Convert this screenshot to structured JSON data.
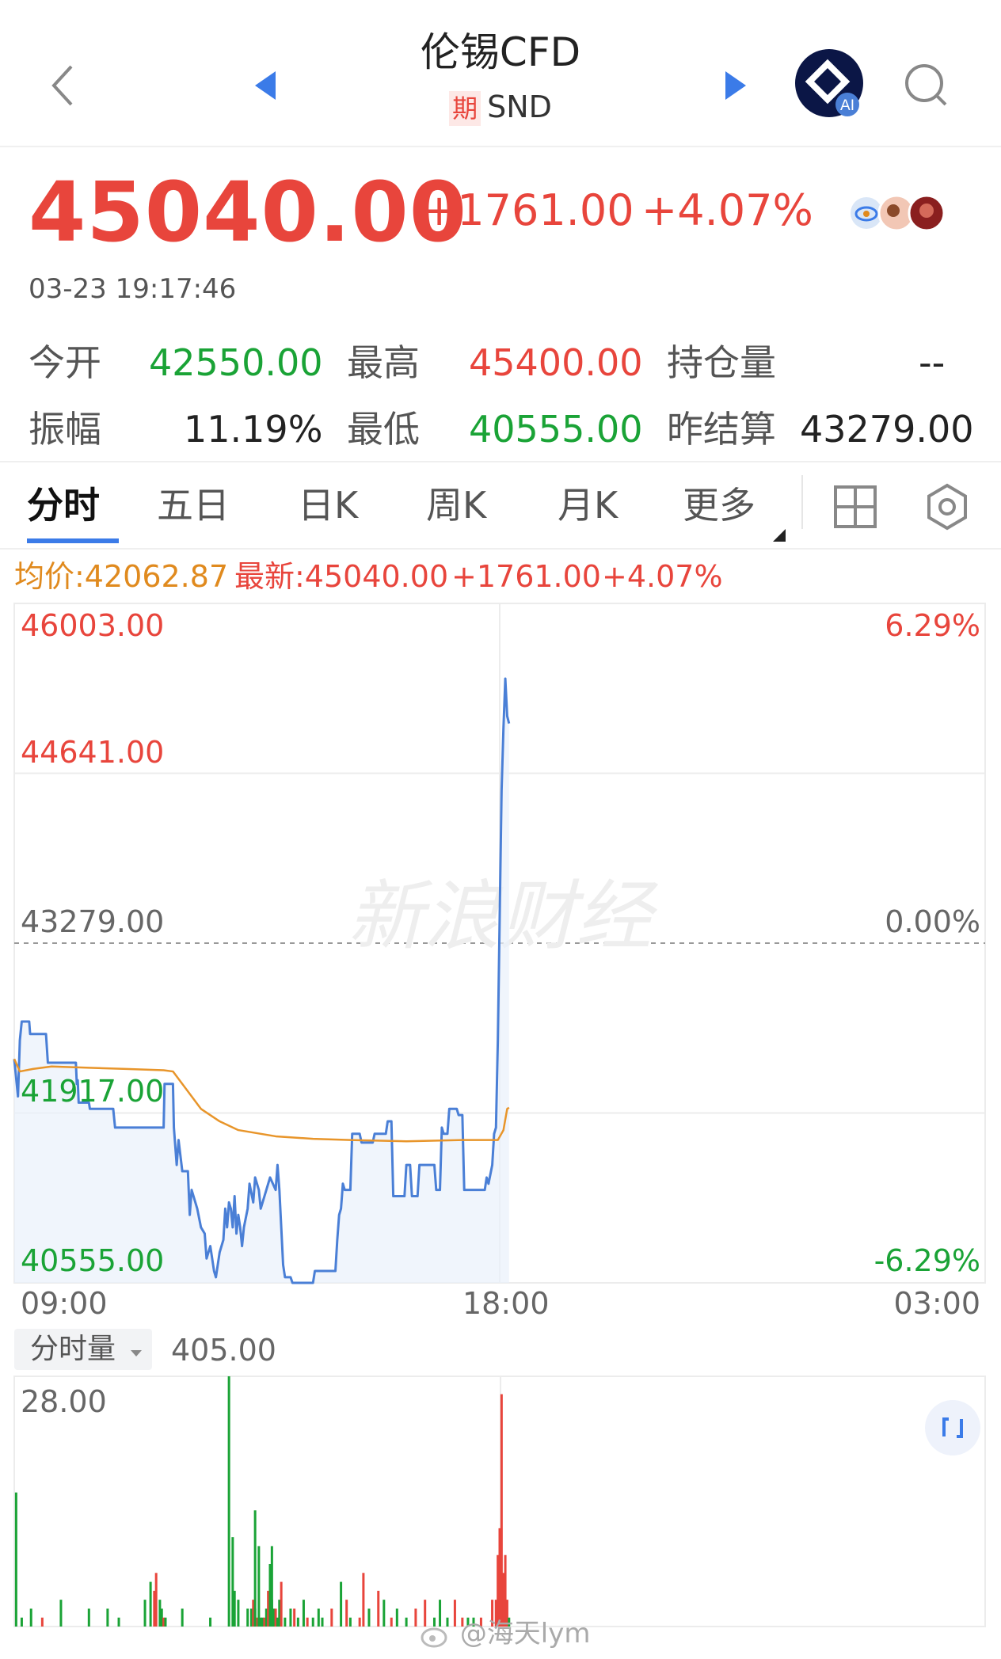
{
  "header": {
    "title": "伦锡CFD",
    "tag": "期",
    "code": "SND",
    "ai_badge": "AI"
  },
  "quote": {
    "price": "45040.00",
    "change": "+1761.00",
    "change_pct": "+4.07%",
    "datetime": "03-23 19:17:46"
  },
  "stats": {
    "open_label": "今开",
    "open": "42550.00",
    "high_label": "最高",
    "high": "45400.00",
    "oi_label": "持仓量",
    "oi": "--",
    "amp_label": "振幅",
    "amp": "11.19%",
    "low_label": "最低",
    "low": "40555.00",
    "settle_label": "昨结算",
    "settle": "43279.00"
  },
  "tabs": [
    {
      "label": "分时",
      "active": true
    },
    {
      "label": "五日"
    },
    {
      "label": "日K"
    },
    {
      "label": "周K"
    },
    {
      "label": "月K"
    },
    {
      "label": "更多"
    }
  ],
  "info_line": {
    "avg": "均价:42062.87",
    "latest": "最新:45040.00",
    "change": "+1761.00",
    "pct": "+4.07%"
  },
  "chart_data": {
    "type": "line",
    "y_left_ticks": [
      "46003.00",
      "44641.00",
      "43279.00",
      "41917.00",
      "40555.00"
    ],
    "y_right_ticks": [
      "6.29%",
      "",
      "0.00%",
      "",
      "-6.29%"
    ],
    "x_ticks": [
      "09:00",
      "18:00",
      "03:00"
    ],
    "ylim": [
      40555,
      46003
    ],
    "reference": 43279,
    "watermark": "新浪财经",
    "series": [
      {
        "color": "#4a7fd6",
        "points": [
          [
            0,
            42350
          ],
          [
            2,
            42050
          ],
          [
            3,
            42500
          ],
          [
            4,
            42650
          ],
          [
            8,
            42650
          ],
          [
            8.5,
            42550
          ],
          [
            17,
            42550
          ],
          [
            18,
            42320
          ],
          [
            33,
            42320
          ],
          [
            33.5,
            42150
          ],
          [
            34,
            42180
          ],
          [
            34.5,
            42000
          ],
          [
            40,
            42000
          ],
          [
            40.5,
            41950
          ],
          [
            53,
            41950
          ],
          [
            54,
            41800
          ],
          [
            80,
            41800
          ],
          [
            80.5,
            42150
          ],
          [
            85,
            42150
          ],
          [
            85.5,
            41800
          ],
          [
            87,
            41500
          ],
          [
            88,
            41700
          ],
          [
            90,
            41450
          ],
          [
            93,
            41450
          ],
          [
            94,
            41100
          ],
          [
            95,
            41300
          ],
          [
            98,
            41150
          ],
          [
            100,
            41000
          ],
          [
            102,
            40950
          ],
          [
            103,
            40750
          ],
          [
            105,
            40850
          ],
          [
            107,
            40650
          ],
          [
            108,
            40600
          ],
          [
            109,
            40700
          ],
          [
            110,
            40800
          ],
          [
            112,
            40900
          ],
          [
            113,
            41150
          ],
          [
            114,
            41000
          ],
          [
            115,
            41200
          ],
          [
            116,
            41150
          ],
          [
            117,
            41000
          ],
          [
            118,
            41250
          ],
          [
            119,
            40950
          ],
          [
            120,
            41100
          ],
          [
            121,
            41000
          ],
          [
            122,
            40850
          ],
          [
            123,
            41000
          ],
          [
            125,
            41150
          ],
          [
            126,
            41350
          ],
          [
            128,
            41200
          ],
          [
            129,
            41400
          ],
          [
            131,
            41300
          ],
          [
            132,
            41150
          ],
          [
            134,
            41250
          ],
          [
            137,
            41400
          ],
          [
            140,
            41300
          ],
          [
            141,
            41500
          ],
          [
            142,
            41300
          ],
          [
            144,
            40700
          ],
          [
            145,
            40600
          ],
          [
            148,
            40600
          ],
          [
            149,
            40555
          ],
          [
            160,
            40555
          ],
          [
            161,
            40650
          ],
          [
            172,
            40650
          ],
          [
            173,
            40900
          ],
          [
            174,
            41100
          ],
          [
            175,
            41150
          ],
          [
            176,
            41350
          ],
          [
            177,
            41300
          ],
          [
            180,
            41300
          ],
          [
            181,
            41750
          ],
          [
            185,
            41750
          ],
          [
            186,
            41680
          ],
          [
            192,
            41680
          ],
          [
            193,
            41750
          ],
          [
            199,
            41750
          ],
          [
            200,
            41850
          ],
          [
            202,
            41850
          ],
          [
            203,
            41250
          ],
          [
            209,
            41250
          ],
          [
            210,
            41500
          ],
          [
            212,
            41500
          ],
          [
            213,
            41250
          ],
          [
            216,
            41250
          ],
          [
            217,
            41500
          ],
          [
            225,
            41500
          ],
          [
            226,
            41300
          ],
          [
            228,
            41300
          ],
          [
            229,
            41800
          ],
          [
            230,
            41750
          ],
          [
            232,
            41750
          ],
          [
            233,
            41950
          ],
          [
            237,
            41950
          ],
          [
            238,
            41900
          ],
          [
            240,
            41900
          ],
          [
            241,
            41300
          ],
          [
            252,
            41300
          ],
          [
            253,
            41400
          ],
          [
            254,
            41350
          ],
          [
            256,
            41500
          ],
          [
            257,
            41750
          ],
          [
            258,
            41800
          ],
          [
            259,
            42500
          ],
          [
            260,
            43500
          ],
          [
            261,
            44500
          ],
          [
            262,
            45000
          ],
          [
            263,
            45400
          ],
          [
            264,
            45100
          ],
          [
            265,
            45040
          ]
        ]
      },
      {
        "color": "#e8952a",
        "points": [
          [
            0,
            42350
          ],
          [
            3,
            42250
          ],
          [
            10,
            42270
          ],
          [
            20,
            42290
          ],
          [
            40,
            42280
          ],
          [
            60,
            42270
          ],
          [
            80,
            42260
          ],
          [
            85,
            42250
          ],
          [
            95,
            42050
          ],
          [
            100,
            41950
          ],
          [
            110,
            41850
          ],
          [
            120,
            41780
          ],
          [
            140,
            41730
          ],
          [
            160,
            41710
          ],
          [
            180,
            41700
          ],
          [
            210,
            41690
          ],
          [
            240,
            41700
          ],
          [
            259,
            41700
          ],
          [
            262,
            41780
          ],
          [
            264,
            41950
          ],
          [
            265,
            41960
          ]
        ]
      }
    ],
    "x_max": 520
  },
  "volume": {
    "selector": "分时量",
    "value": "405.00",
    "ytick": "28.00",
    "chart_data": {
      "type": "bar",
      "ylim": [
        0,
        28
      ],
      "bars": [
        [
          1,
          15,
          "g"
        ],
        [
          4,
          1,
          "g"
        ],
        [
          9,
          2,
          "g"
        ],
        [
          15,
          1,
          "r"
        ],
        [
          25,
          3,
          "g"
        ],
        [
          40,
          2,
          "g"
        ],
        [
          50,
          2,
          "g"
        ],
        [
          56,
          1,
          "g"
        ],
        [
          70,
          3,
          "g"
        ],
        [
          73,
          5,
          "g"
        ],
        [
          75,
          4,
          "r"
        ],
        [
          76,
          6,
          "r"
        ],
        [
          78,
          3,
          "g"
        ],
        [
          79,
          2,
          "g"
        ],
        [
          80,
          1,
          "r"
        ],
        [
          81,
          1,
          "g"
        ],
        [
          90,
          2,
          "g"
        ],
        [
          105,
          1,
          "g"
        ],
        [
          118,
          4,
          "g"
        ],
        [
          120,
          3,
          "g"
        ],
        [
          125,
          2,
          "g"
        ],
        [
          127,
          2,
          "g"
        ],
        [
          128,
          3,
          "r"
        ],
        [
          129,
          2,
          "g"
        ],
        [
          130,
          1,
          "r"
        ],
        [
          131,
          1,
          "g"
        ],
        [
          132,
          1,
          "g"
        ],
        [
          133,
          1,
          "g"
        ],
        [
          134,
          1,
          "r"
        ],
        [
          135,
          2,
          "g"
        ],
        [
          136,
          4,
          "r"
        ],
        [
          137,
          2,
          "r"
        ],
        [
          138,
          3,
          "g"
        ],
        [
          139,
          2,
          "g"
        ],
        [
          140,
          2,
          "r"
        ],
        [
          141,
          1,
          "g"
        ],
        [
          142,
          3,
          "g"
        ],
        [
          143,
          5,
          "r"
        ],
        [
          145,
          1,
          "g"
        ],
        [
          148,
          2,
          "g"
        ],
        [
          150,
          2,
          "r"
        ],
        [
          152,
          1,
          "g"
        ],
        [
          155,
          3,
          "g"
        ],
        [
          157,
          1,
          "r"
        ],
        [
          160,
          1,
          "g"
        ],
        [
          163,
          2,
          "g"
        ],
        [
          165,
          1,
          "g"
        ],
        [
          170,
          2,
          "r"
        ],
        [
          175,
          5,
          "g"
        ],
        [
          178,
          3,
          "r"
        ],
        [
          180,
          1,
          "g"
        ],
        [
          185,
          1,
          "r"
        ],
        [
          187,
          6,
          "r"
        ],
        [
          190,
          2,
          "g"
        ],
        [
          195,
          4,
          "r"
        ],
        [
          198,
          3,
          "g"
        ],
        [
          202,
          1,
          "r"
        ],
        [
          205,
          2,
          "g"
        ],
        [
          210,
          1,
          "g"
        ],
        [
          215,
          2,
          "r"
        ],
        [
          220,
          3,
          "r"
        ],
        [
          225,
          1,
          "g"
        ],
        [
          228,
          3,
          "g"
        ],
        [
          232,
          1,
          "g"
        ],
        [
          236,
          3,
          "r"
        ],
        [
          240,
          1,
          "r"
        ],
        [
          243,
          1,
          "g"
        ],
        [
          246,
          1,
          "g"
        ],
        [
          250,
          1,
          "r"
        ],
        [
          256,
          3,
          "r"
        ],
        [
          258,
          3,
          "r"
        ],
        [
          259,
          8,
          "r"
        ],
        [
          260,
          11,
          "r"
        ],
        [
          261,
          26,
          "r"
        ],
        [
          262,
          6,
          "r"
        ],
        [
          263,
          8,
          "r"
        ],
        [
          264,
          3,
          "r"
        ],
        [
          265,
          1,
          "g"
        ]
      ],
      "green_spikes": [
        [
          115,
          28,
          "g"
        ],
        [
          117,
          10,
          "g"
        ],
        [
          129,
          13,
          "g"
        ],
        [
          131,
          9,
          "g"
        ],
        [
          137,
          7,
          "g"
        ],
        [
          138,
          9,
          "g"
        ]
      ]
    }
  },
  "watermark_user": "@海天lym"
}
